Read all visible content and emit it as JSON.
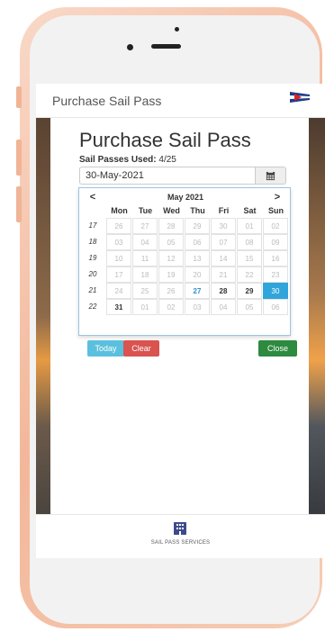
{
  "app": {
    "header_title": "Purchase Sail Pass",
    "flag_icon": "burgee-flag-icon"
  },
  "page": {
    "title": "Purchase Sail Pass",
    "used_label": "Sail Passes Used:",
    "used_value": "4/25",
    "date_value": "30-May-2021",
    "calendar_icon": "calendar-icon"
  },
  "datepicker": {
    "prev": "<",
    "next": ">",
    "month_label": "May 2021",
    "weekdays": [
      "Mon",
      "Tue",
      "Wed",
      "Thu",
      "Fri",
      "Sat",
      "Sun"
    ],
    "weeks": [
      {
        "num": "17",
        "days": [
          {
            "d": "26",
            "s": "off"
          },
          {
            "d": "27",
            "s": "off"
          },
          {
            "d": "28",
            "s": "off"
          },
          {
            "d": "29",
            "s": "off"
          },
          {
            "d": "30",
            "s": "off"
          },
          {
            "d": "01",
            "s": "off"
          },
          {
            "d": "02",
            "s": "off"
          }
        ]
      },
      {
        "num": "18",
        "days": [
          {
            "d": "03",
            "s": "off"
          },
          {
            "d": "04",
            "s": "off"
          },
          {
            "d": "05",
            "s": "off"
          },
          {
            "d": "06",
            "s": "off"
          },
          {
            "d": "07",
            "s": "off"
          },
          {
            "d": "08",
            "s": "off"
          },
          {
            "d": "09",
            "s": "off"
          }
        ]
      },
      {
        "num": "19",
        "days": [
          {
            "d": "10",
            "s": "off"
          },
          {
            "d": "11",
            "s": "off"
          },
          {
            "d": "12",
            "s": "off"
          },
          {
            "d": "13",
            "s": "off"
          },
          {
            "d": "14",
            "s": "off"
          },
          {
            "d": "15",
            "s": "off"
          },
          {
            "d": "16",
            "s": "off"
          }
        ]
      },
      {
        "num": "20",
        "days": [
          {
            "d": "17",
            "s": "off"
          },
          {
            "d": "18",
            "s": "off"
          },
          {
            "d": "19",
            "s": "off"
          },
          {
            "d": "20",
            "s": "off"
          },
          {
            "d": "21",
            "s": "off"
          },
          {
            "d": "22",
            "s": "off"
          },
          {
            "d": "23",
            "s": "off"
          }
        ]
      },
      {
        "num": "21",
        "days": [
          {
            "d": "24",
            "s": "off"
          },
          {
            "d": "25",
            "s": "off"
          },
          {
            "d": "26",
            "s": "off"
          },
          {
            "d": "27",
            "s": "today"
          },
          {
            "d": "28",
            "s": "bold"
          },
          {
            "d": "29",
            "s": "bold"
          },
          {
            "d": "30",
            "s": "sel"
          }
        ]
      },
      {
        "num": "22",
        "days": [
          {
            "d": "31",
            "s": "bold"
          },
          {
            "d": "01",
            "s": "off"
          },
          {
            "d": "02",
            "s": "off"
          },
          {
            "d": "03",
            "s": "off"
          },
          {
            "d": "04",
            "s": "off"
          },
          {
            "d": "05",
            "s": "off"
          },
          {
            "d": "06",
            "s": "off"
          }
        ]
      }
    ],
    "today_label": "Today",
    "clear_label": "Clear",
    "close_label": "Close"
  },
  "tabbar": {
    "label": "SAIL PASS SERVICES",
    "icon": "building-icon"
  },
  "colors": {
    "selected": "#30a5db",
    "today_btn": "#5bc0de",
    "clear_btn": "#d9534f",
    "close_btn": "#2d8a3f",
    "phone": "#f3b79a"
  }
}
